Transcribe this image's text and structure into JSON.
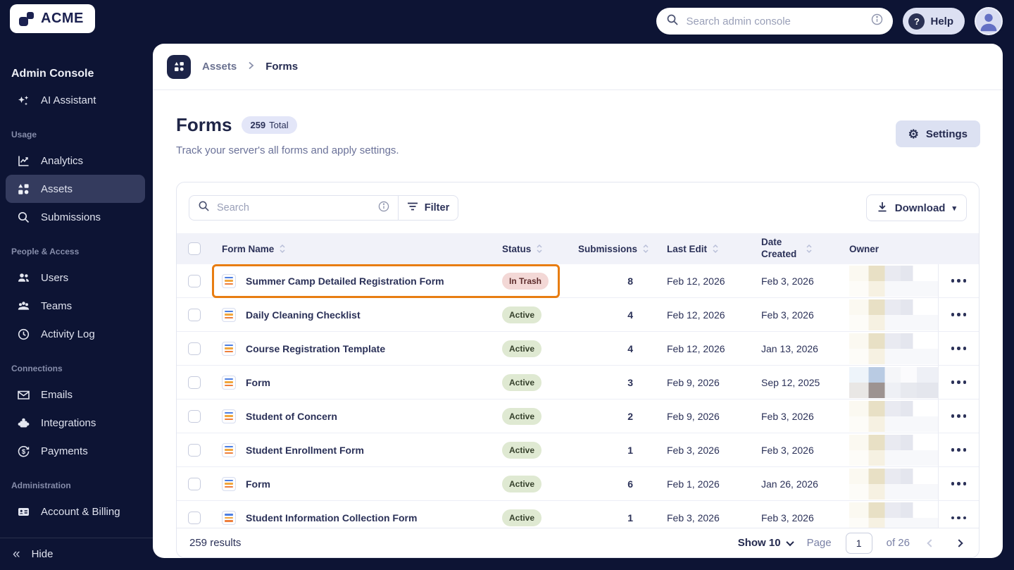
{
  "topbar": {
    "logo": "ACME",
    "search_placeholder": "Search admin console",
    "help": "Help"
  },
  "sidebar": {
    "title": "Admin Console",
    "assistant": "AI Assistant",
    "sections": [
      {
        "label": "Usage",
        "items": [
          {
            "label": "Analytics"
          },
          {
            "label": "Assets"
          },
          {
            "label": "Submissions"
          }
        ]
      },
      {
        "label": "People & Access",
        "items": [
          {
            "label": "Users"
          },
          {
            "label": "Teams"
          },
          {
            "label": "Activity Log"
          }
        ]
      },
      {
        "label": "Connections",
        "items": [
          {
            "label": "Emails"
          },
          {
            "label": "Integrations"
          },
          {
            "label": "Payments"
          }
        ]
      },
      {
        "label": "Administration",
        "items": [
          {
            "label": "Account & Billing"
          }
        ]
      }
    ],
    "hide": "Hide"
  },
  "breadcrumb": {
    "parent": "Assets",
    "current": "Forms"
  },
  "page": {
    "title": "Forms",
    "total_count": "259",
    "total_label": "Total",
    "subtitle": "Track your server's all forms and apply settings.",
    "settings": "Settings"
  },
  "toolbar": {
    "search_placeholder": "Search",
    "filter": "Filter",
    "download": "Download"
  },
  "table": {
    "columns": {
      "name": "Form Name",
      "status": "Status",
      "submissions": "Submissions",
      "last_edit": "Last Edit",
      "date_created": "Date Created",
      "owner": "Owner"
    },
    "rows": [
      {
        "name": "Summer Camp Detailed Registration Form",
        "status": "In Trash",
        "submissions": "8",
        "last_edit": "Feb 12, 2026",
        "date_created": "Feb 3, 2026",
        "highlighted": true
      },
      {
        "name": "Daily Cleaning Checklist",
        "status": "Active",
        "submissions": "4",
        "last_edit": "Feb 12, 2026",
        "date_created": "Feb 3, 2026"
      },
      {
        "name": "Course Registration Template",
        "status": "Active",
        "submissions": "4",
        "last_edit": "Feb 12, 2026",
        "date_created": "Jan 13, 2026"
      },
      {
        "name": "Form",
        "status": "Active",
        "submissions": "3",
        "last_edit": "Feb 9, 2026",
        "date_created": "Sep 12, 2025"
      },
      {
        "name": "Student of Concern",
        "status": "Active",
        "submissions": "2",
        "last_edit": "Feb 9, 2026",
        "date_created": "Feb 3, 2026"
      },
      {
        "name": "Student Enrollment Form",
        "status": "Active",
        "submissions": "1",
        "last_edit": "Feb 3, 2026",
        "date_created": "Feb 3, 2026"
      },
      {
        "name": "Form",
        "status": "Active",
        "submissions": "6",
        "last_edit": "Feb 1, 2026",
        "date_created": "Jan 26, 2026"
      },
      {
        "name": "Student Information Collection Form",
        "status": "Active",
        "submissions": "1",
        "last_edit": "Feb 3, 2026",
        "date_created": "Feb 3, 2026"
      }
    ]
  },
  "pagination": {
    "results": "259 results",
    "show": "Show 10",
    "page_label": "Page",
    "page_value": "1",
    "of": "of 26"
  },
  "colors": {
    "topbar_bg": "#0d1434",
    "sidebar_active_bg": "#343b5e",
    "highlight_orange": "#e87d12",
    "active_badge_bg": "#dfe9d2",
    "trash_badge_bg": "#f3d8d6",
    "accent_lavender": "#dce1f2",
    "table_header_bg": "#f1f2f9"
  }
}
